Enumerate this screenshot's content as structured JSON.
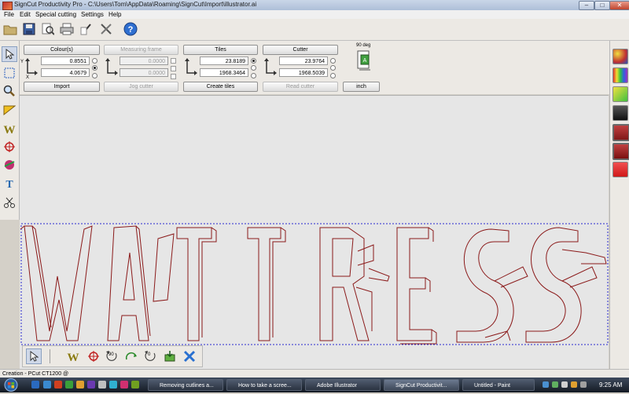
{
  "window": {
    "title": "SignCut Productivity Pro - C:\\Users\\Tom\\AppData\\Roaming\\SignCut\\Import\\illustrator.ai"
  },
  "menu": {
    "items": [
      "File",
      "Edit",
      "Special cutting",
      "Settings",
      "Help"
    ]
  },
  "panel": {
    "colours": {
      "label": "Colour(s)",
      "value1": "0.8551",
      "value2": "4.0679",
      "action": "Import"
    },
    "measuring": {
      "label": "Measuring frame",
      "value1": "0.0000",
      "value2": "0.0000",
      "action": "Jog cutter"
    },
    "tiles": {
      "label": "Tiles",
      "value1": "23.8189",
      "value2": "1968.3464",
      "action": "Create tiles"
    },
    "cutter": {
      "label": "Cutter",
      "value1": "23.9764",
      "value2": "1968.5039",
      "action": "Read cutter"
    },
    "rotate": {
      "label": "90 deg",
      "unit": "inch"
    },
    "axis": {
      "x": "X",
      "y": "Y"
    }
  },
  "canvas": {
    "artwork": "MATTRESS"
  },
  "bottom_tools": {
    "rotate90": "90",
    "rotate0": "0"
  },
  "status": {
    "text": "Creation - PCut CT1200 @"
  },
  "taskbar": {
    "tasks": [
      "Removing cutlines a...",
      "How to take a scree...",
      "Adobe Illustrator",
      "SignCut Productivit...",
      "Untitled - Paint"
    ],
    "clock": "9:25 AM"
  },
  "colors": {
    "accent": "#8b1a1a",
    "selection": "#2a2ad0",
    "titlebar": "#c9d6e8"
  }
}
